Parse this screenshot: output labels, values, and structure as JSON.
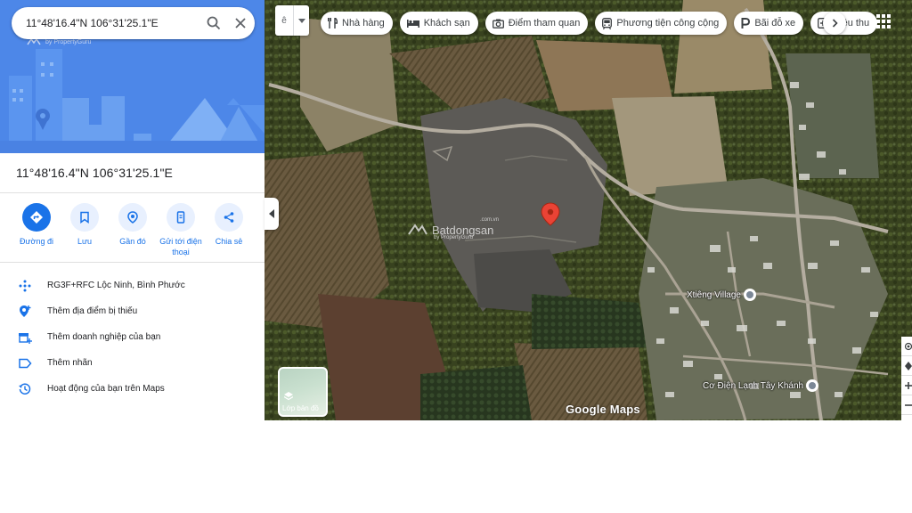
{
  "search": {
    "value": "11°48'16.4\"N 106°31'25.1\"E"
  },
  "hero": {
    "watermark_by": "by PropertyGuru"
  },
  "place": {
    "title": "11°48'16.4\"N 106°31'25.1\"E"
  },
  "actions": [
    {
      "label": "Đường đi",
      "icon": "directions-icon"
    },
    {
      "label": "Lưu",
      "icon": "bookmark-icon"
    },
    {
      "label": "Gần đó",
      "icon": "nearby-icon"
    },
    {
      "label": "Gửi tới điện thoại",
      "icon": "phone-icon"
    },
    {
      "label": "Chia sẻ",
      "icon": "share-icon"
    }
  ],
  "info": [
    {
      "text": "RG3F+RFC Lộc Ninh, Bình Phước",
      "icon": "plus-code-icon"
    },
    {
      "text": "Thêm địa điểm bị thiếu",
      "icon": "add-place-icon"
    },
    {
      "text": "Thêm doanh nghiệp của bạn",
      "icon": "add-business-icon"
    },
    {
      "text": "Thêm nhãn",
      "icon": "label-icon"
    },
    {
      "text": "Hoạt động của bạn trên Maps",
      "icon": "history-icon"
    }
  ],
  "map": {
    "lang_value": "ê",
    "chips": [
      {
        "label": "Nhà hàng",
        "icon": "restaurant-icon"
      },
      {
        "label": "Khách sạn",
        "icon": "hotel-icon"
      },
      {
        "label": "Điểm tham quan",
        "icon": "camera-icon"
      },
      {
        "label": "Phương tiện công cộng",
        "icon": "transit-icon"
      },
      {
        "label": "Bãi đỗ xe",
        "icon": "parking-icon"
      },
      {
        "label": "Hiệu thu",
        "icon": "pharmacy-icon"
      }
    ],
    "layers_label": "Lớp bản đồ",
    "google_logo": "Google Maps",
    "watermark": {
      "name": "Batdongsan",
      "tld": ".com.vn",
      "by": "by PropertyGuru"
    },
    "pois": [
      {
        "label": "Xtiêng Village"
      },
      {
        "label": "Cơ Điện Lạnh Tây Khánh"
      }
    ],
    "colors": {
      "marker": "#ea4335",
      "accent": "#1a73e8",
      "hero": "#4d87e8"
    }
  }
}
